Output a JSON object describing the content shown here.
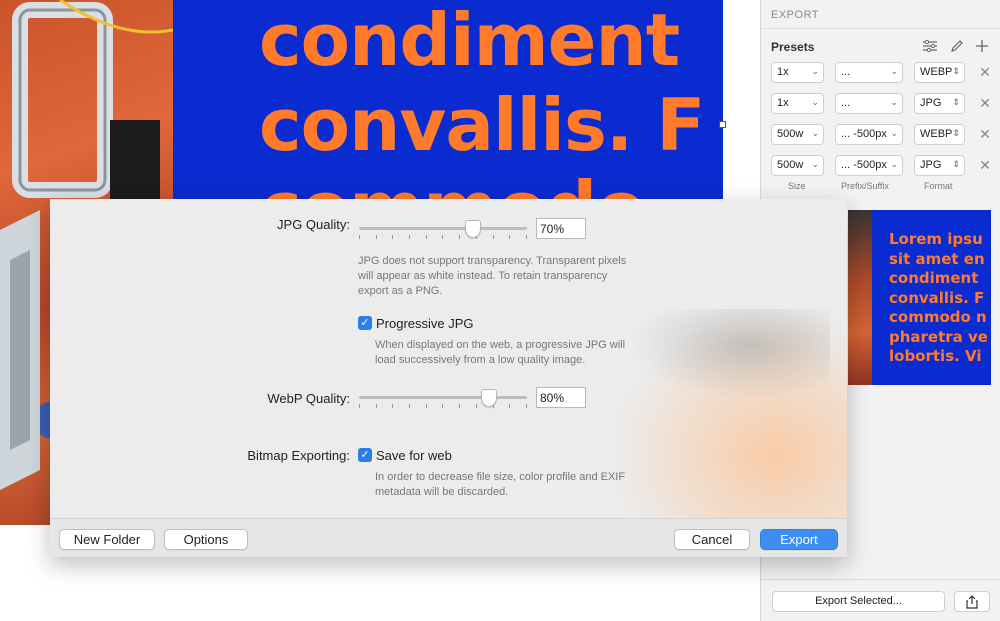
{
  "canvas": {
    "text_lines": [
      "condiment",
      "convallis. F",
      "commodo"
    ]
  },
  "inspector": {
    "title": "EXPORT",
    "presets_label": "Presets",
    "tools": [
      "sliders-icon",
      "pencil-icon",
      "plus-icon"
    ],
    "presets": [
      {
        "size": "1x",
        "prefix": "...",
        "format": "WEBP"
      },
      {
        "size": "1x",
        "prefix": "...",
        "format": "JPG"
      },
      {
        "size": "500w",
        "prefix": "... -500px",
        "format": "WEBP"
      },
      {
        "size": "500w",
        "prefix": "... -500px",
        "format": "JPG"
      }
    ],
    "column_headers": {
      "size": "Size",
      "prefix": "Prefix/Suffix",
      "format": "Format"
    },
    "preview_lines": [
      "Lorem ipsu",
      "sit amet en",
      "condiment",
      "convallis. F",
      "commodo n",
      "pharetra ve",
      "lobortis. Vi"
    ],
    "export_selected_label": "Export Selected..."
  },
  "options": {
    "jpg_quality_label": "JPG Quality:",
    "jpg_quality_value": "70%",
    "jpg_quality_level": 0.7,
    "jpg_help": "JPG does not support transparency. Transparent pixels will appear as white instead. To retain transparency export as a PNG.",
    "progressive_label": "Progressive JPG",
    "progressive_checked": true,
    "progressive_help": "When displayed on the web, a progressive JPG will load successively from a low quality image.",
    "webp_quality_label": "WebP Quality:",
    "webp_quality_value": "80%",
    "webp_quality_level": 0.8,
    "bitmap_label": "Bitmap Exporting:",
    "save_for_web_label": "Save for web",
    "save_for_web_checked": true,
    "save_for_web_help": "In order to decrease file size, color profile and EXIF metadata will be discarded."
  },
  "footer": {
    "new_folder": "New Folder",
    "options": "Options",
    "cancel": "Cancel",
    "export": "Export"
  },
  "colors": {
    "artboard_blue": "#0a2bd0",
    "text_orange": "#ff7a2b",
    "accent_blue": "#3d8ef0"
  }
}
